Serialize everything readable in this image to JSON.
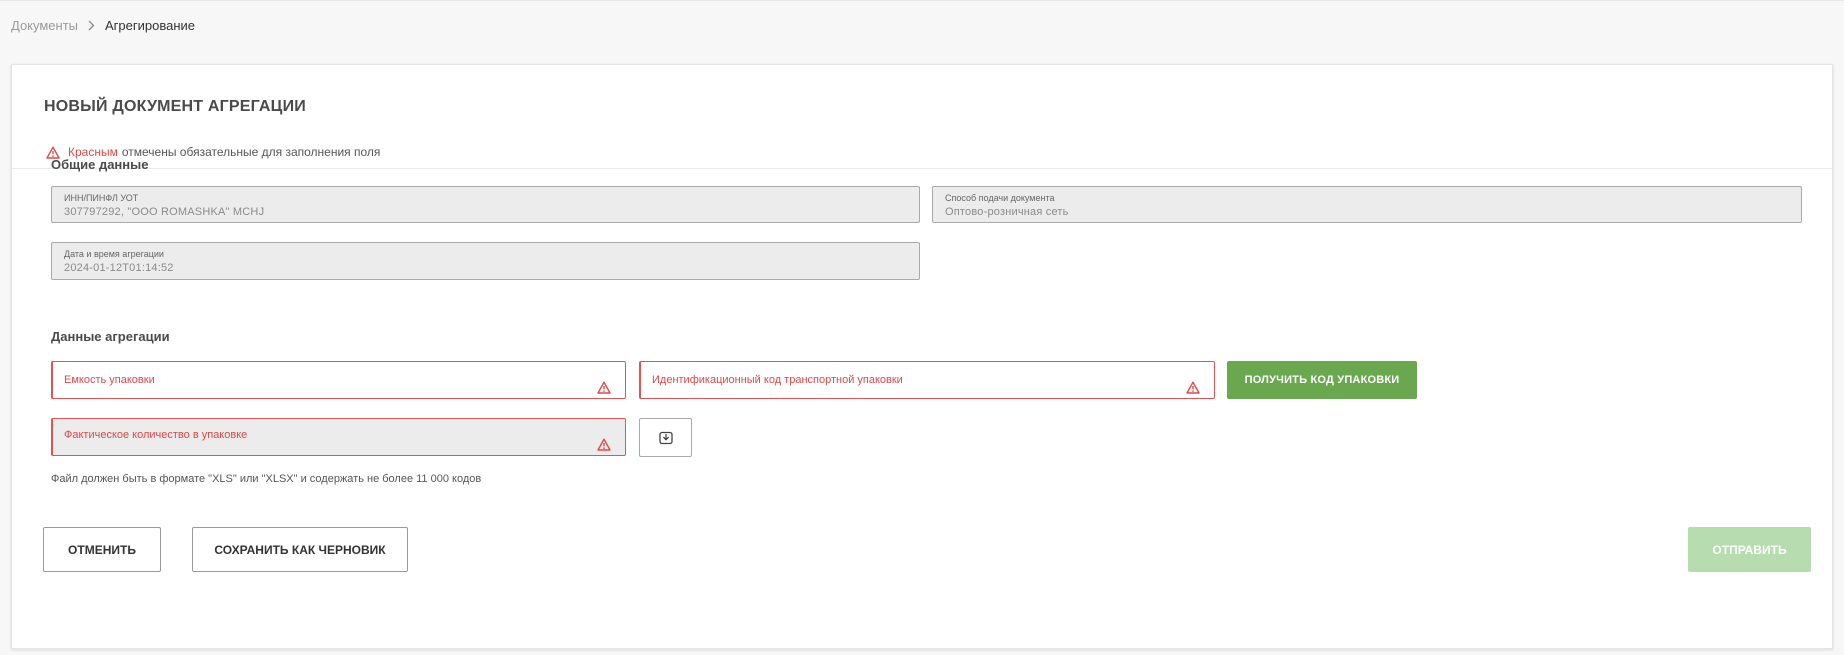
{
  "breadcrumb": {
    "root": "Документы",
    "current": "Агрегирование"
  },
  "page": {
    "title": "НОВЫЙ ДОКУМЕНТ АГРЕГАЦИИ",
    "required_note_highlight": "Красным",
    "required_note_rest": "отмечены обязательные для заполнения поля"
  },
  "general": {
    "heading": "Общие данные",
    "inn": {
      "label": "ИНН/ПИНФЛ УОТ",
      "value": "307797292, \"ООО ROMASHKA\" MCHJ"
    },
    "method": {
      "label": "Способ подачи документа",
      "value": "Оптово-розничная сеть"
    },
    "datetime": {
      "label": "Дата и время агрегации",
      "value": "2024-01-12T01:14:52"
    }
  },
  "aggregation": {
    "heading": "Данные агрегации",
    "capacity_placeholder": "Емкость упаковки",
    "transport_code_placeholder": "Идентификационный код транспортной упаковки",
    "get_code_button": "ПОЛУЧИТЬ КОД УПАКОВКИ",
    "actual_qty_placeholder": "Фактическое количество в упаковке",
    "file_hint": "Файл должен быть в формате \"XLS\" или \"XLSX\" и содержать не более 11 000 кодов"
  },
  "actions": {
    "cancel": "ОТМЕНИТЬ",
    "save_draft": "СОХРАНИТЬ КАК ЧЕРНОВИК",
    "submit": "ОТПРАВИТЬ"
  },
  "icons": {
    "breadcrumb_separator": "chevron-right-icon",
    "required": "warning-triangle-icon",
    "upload": "download-tray-icon"
  },
  "colors": {
    "error": "#e04848",
    "primary_green": "#6aa84f",
    "disabled_green": "#b7dcb0"
  }
}
